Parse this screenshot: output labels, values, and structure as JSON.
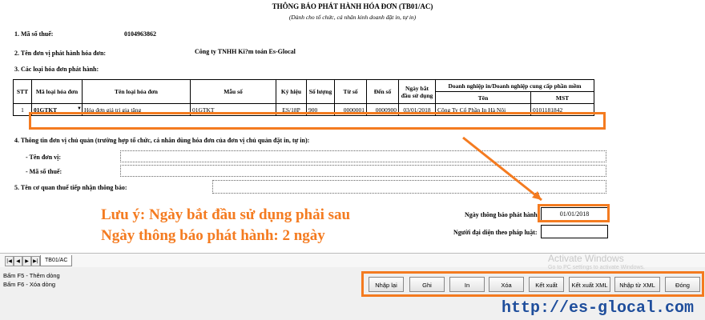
{
  "form": {
    "title": "THÔNG BÁO PHÁT HÀNH HÓA ĐƠN (TB01/AC)",
    "subtitle": "(Dành cho tổ chức, cá nhân kinh doanh đặt in, tự in)"
  },
  "section1": {
    "label": "1. Mã số thuế:",
    "value": "0104963862"
  },
  "section2": {
    "label": "2. Tên đơn vị phát hành hóa đơn:",
    "value": "Công ty TNHH Ki?m toán Es-Glocal"
  },
  "section3": {
    "label": "3. Các loại hóa đơn phát hành:"
  },
  "table": {
    "headers": {
      "stt": "STT",
      "ma_loai": "Mã loại hóa đơn",
      "ten_loai": "Tên loại hóa đơn",
      "mau_so": "Mẫu số",
      "ky_hieu": "Ký hiệu",
      "so_luong": "Số lượng",
      "tu_so": "Từ số",
      "den_so": "Đến số",
      "ngay_bat_dau": "Ngày bắt đầu sử dụng",
      "dn_in": "Doanh nghiệp in/Doanh nghiệp cung cấp phần mềm",
      "ten": "Tên",
      "mst": "MST"
    },
    "row": {
      "stt": "1",
      "ma_loai": "01GTKT",
      "ten_loai": "Hóa đơn giá trị gia tăng",
      "mau_so": "01GTKT",
      "ky_hieu": "ES/18P",
      "so_luong": "900",
      "tu_so": "0000001",
      "den_so": "0000900",
      "ngay_bat_dau": "03/01/2018",
      "ten": "Công Ty Cổ Phần In Hà Nội",
      "mst": "0101181842"
    }
  },
  "section4": {
    "label": "4. Thông tin đơn vị chủ quản (trường hợp tổ chức, cá nhân dùng hóa đơn của đơn vị chủ quản đặt in, tự in):",
    "ten_label": "- Tên đơn vị:",
    "mst_label": "- Mã số thuế:"
  },
  "section5": {
    "label": "5. Tên cơ quan thuế tiếp nhận thông báo:"
  },
  "note": {
    "line1": "Lưu ý: Ngày bắt đầu sử dụng phải sau",
    "line2": "Ngày thông báo phát hành: 2 ngày"
  },
  "ngay_thong_bao": {
    "label": "Ngày thông báo phát hành:",
    "value": "01/01/2018"
  },
  "nguoi_dai_dien": {
    "label": "Người đại diện theo pháp luật:"
  },
  "sheet_tab": "TB01/AC",
  "nav_icons": [
    "first-icon",
    "prev-icon",
    "next-icon",
    "last-icon"
  ],
  "nav_glyphs": [
    "|◀",
    "◀",
    "▶",
    "▶|"
  ],
  "hints": [
    "Bấm F5 - Thêm dòng",
    "Bấm F6 - Xóa dòng"
  ],
  "buttons": {
    "nhap_lai": "Nhập lại",
    "ghi": "Ghi",
    "in": "In",
    "xoa": "Xóa",
    "ket_xuat": "Kết xuất",
    "ket_xuat_xml": "Kết xuất XML",
    "nhap_tu_xml": "Nhập từ XML",
    "dong": "Đóng"
  },
  "watermark": {
    "title": "Activate Windows",
    "sub": "Go to PC settings to activate Windows."
  },
  "website": "http://es-glocal.com",
  "colors": {
    "accent": "#f47b20",
    "link": "#1f4e9c"
  }
}
